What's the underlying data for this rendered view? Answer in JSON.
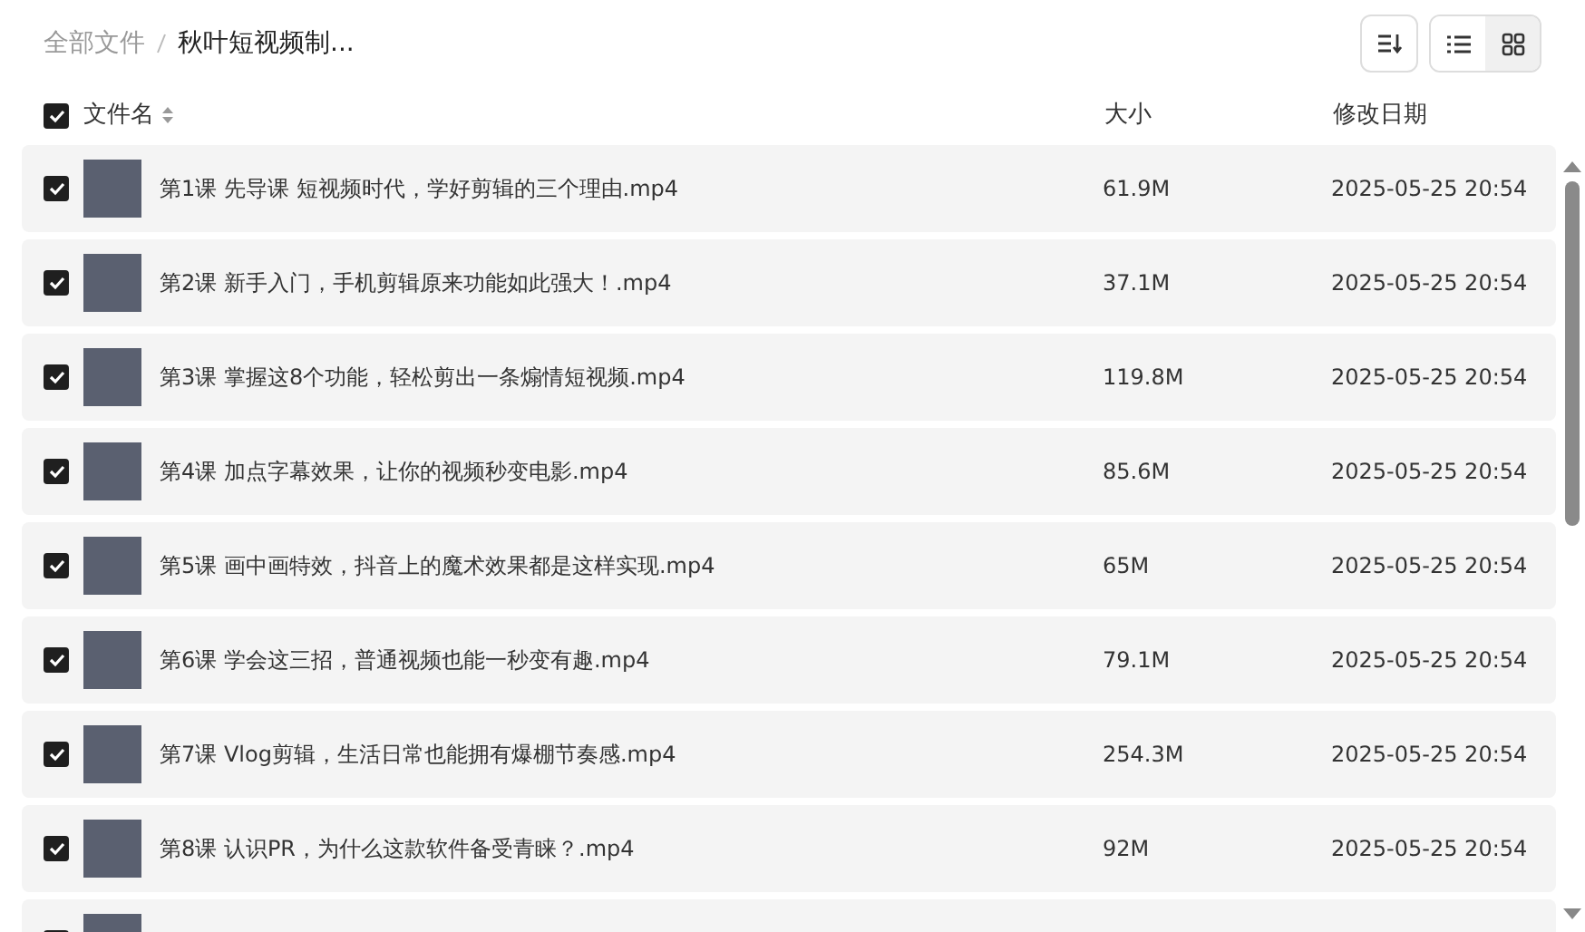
{
  "breadcrumb": [
    {
      "label": "全部文件",
      "current": false
    },
    {
      "label": "秋叶短视频制...",
      "current": true
    }
  ],
  "view_toggle": [
    {
      "kind": "list",
      "selected": false
    },
    {
      "kind": "grid",
      "selected": true
    }
  ],
  "header": {
    "checked": true,
    "name": "文件名",
    "size": "大小",
    "date": "修改日期"
  },
  "files": [
    {
      "checked": true,
      "name": "第1课 先导课 短视频时代，学好剪辑的三个理由.mp4",
      "size": "61.9M",
      "date": "2025-05-25 20:54"
    },
    {
      "checked": true,
      "name": "第2课 新手入门，手机剪辑原来功能如此强大！.mp4",
      "size": "37.1M",
      "date": "2025-05-25 20:54"
    },
    {
      "checked": true,
      "name": "第3课 掌握这8个功能，轻松剪出一条煽情短视频.mp4",
      "size": "119.8M",
      "date": "2025-05-25 20:54"
    },
    {
      "checked": true,
      "name": "第4课 加点字幕效果，让你的视频秒变电影.mp4",
      "size": "85.6M",
      "date": "2025-05-25 20:54"
    },
    {
      "checked": true,
      "name": "第5课 画中画特效，抖音上的魔术效果都是这样实现.mp4",
      "size": "65M",
      "date": "2025-05-25 20:54"
    },
    {
      "checked": true,
      "name": "第6课 学会这三招，普通视频也能一秒变有趣.mp4",
      "size": "79.1M",
      "date": "2025-05-25 20:54"
    },
    {
      "checked": true,
      "name": "第7课 Vlog剪辑，生活日常也能拥有爆棚节奏感.mp4",
      "size": "254.3M",
      "date": "2025-05-25 20:54"
    },
    {
      "checked": true,
      "name": "第8课 认识PR，为什么这款软件备受青睐？.mp4",
      "size": "92M",
      "date": "2025-05-25 20:54"
    },
    {
      "checked": true
    }
  ]
}
